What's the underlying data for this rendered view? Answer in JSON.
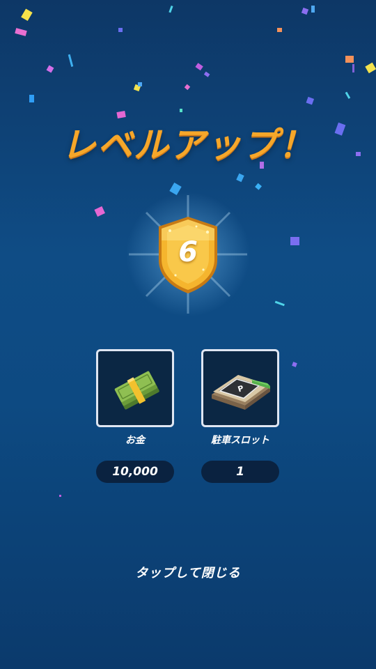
{
  "title": "レベルアップ！",
  "level": "6",
  "rewards": [
    {
      "label": "お金",
      "value": "10,000",
      "icon": "money-stack-icon"
    },
    {
      "label": "駐車スロット",
      "value": "1",
      "icon": "parking-slot-icon"
    }
  ],
  "close_hint": "タップして閉じる",
  "colors": {
    "background_top": "#0d3766",
    "background_mid": "#0f4c85",
    "title": "#f6a72a",
    "badge_gold": "#f5b52e",
    "reward_box_border": "#dfe6f2",
    "pill_bg": "#0a2240"
  }
}
